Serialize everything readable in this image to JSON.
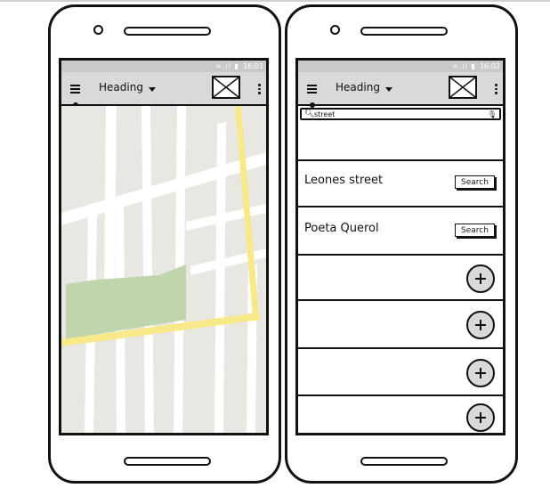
{
  "left_phone": {
    "status_time": "16:01",
    "appbar": {
      "title": "Heading"
    }
  },
  "right_phone": {
    "status_time": "16:02",
    "appbar": {
      "title": "Heading"
    },
    "search": {
      "value": "street"
    },
    "results": [
      {
        "name": "Leones street",
        "button": "Search"
      },
      {
        "name": "Poeta Querol",
        "button": "Search"
      }
    ]
  }
}
